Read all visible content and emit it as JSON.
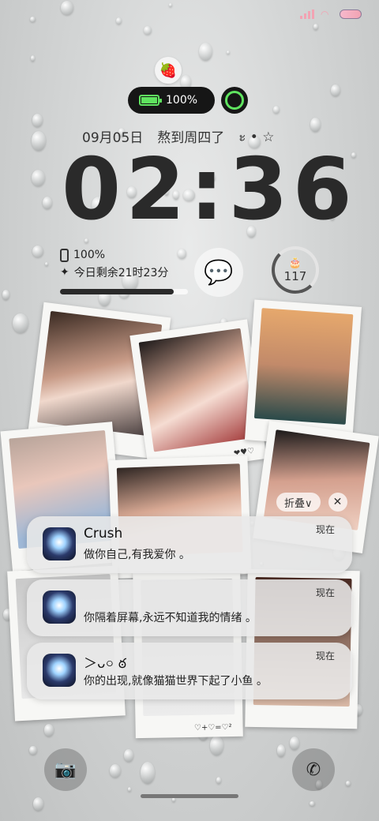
{
  "status": {
    "signal_color": "#f2a3b3",
    "battery_color": "#f2a3b3"
  },
  "widget": {
    "top_icon": "strawberry-icon",
    "battery_percent_label": "100%",
    "battery_level": 1.0,
    "accent": "#5fe35f"
  },
  "date_line": {
    "date": "09月05日",
    "message": "熬到周四了",
    "decor": "ะ • ☆"
  },
  "clock": {
    "time": "02:36"
  },
  "info": {
    "phone_battery": "100%",
    "remaining": "今日剩余21时23分",
    "day_progress": 0.89,
    "wechat_icon": "wechat-icon",
    "cake_icon": "cake-icon",
    "countdown": "117"
  },
  "photos": {
    "hearts1": "❤♥♡",
    "hearts2": "♡+♡=♡²"
  },
  "notif_controls": {
    "fold": "折叠∨",
    "close": "✕"
  },
  "notifications": [
    {
      "title": "Crush",
      "body": "做你自己,有我爱你 。",
      "time": "现在"
    },
    {
      "title": "",
      "body": "你隔着屏幕,永远不知道我的情绪 。",
      "time": "现在"
    },
    {
      "title": "＞ᴗ০ ఠ",
      "body": "你的出现,就像猫猫世界下起了小鱼 。",
      "time": "现在"
    }
  ],
  "dock": {
    "camera_icon": "camera-icon",
    "phone_icon": "phone-icon"
  }
}
